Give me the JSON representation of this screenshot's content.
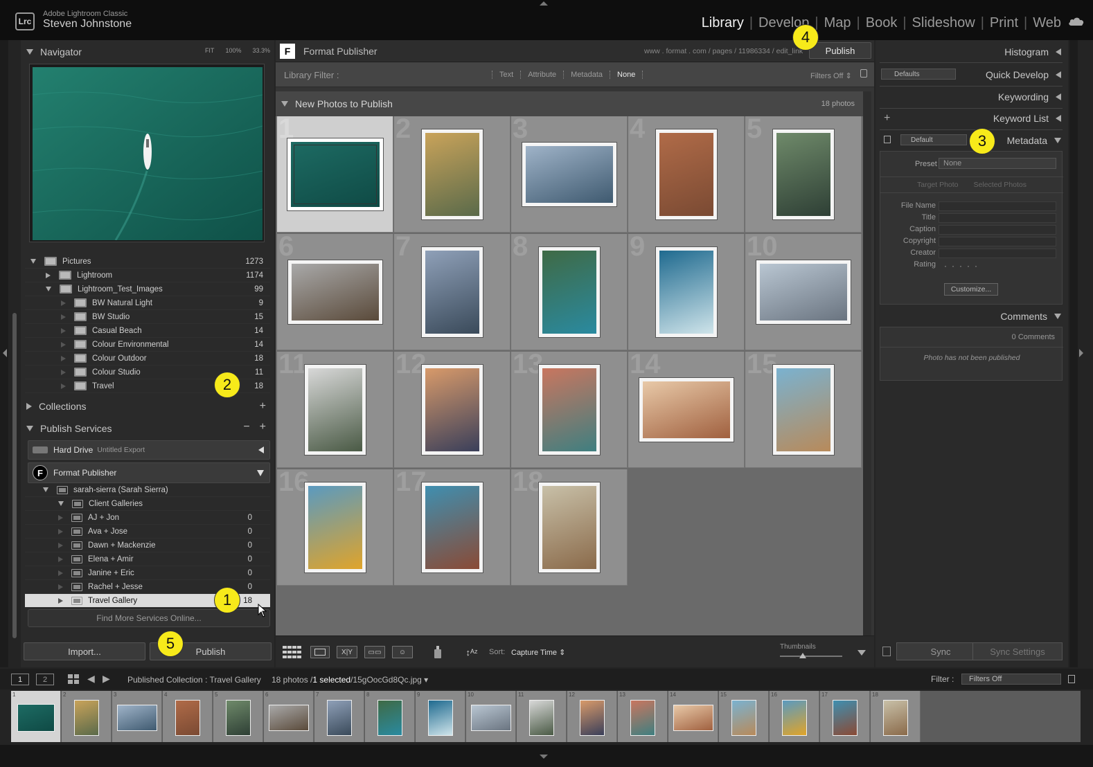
{
  "app": {
    "title": "Adobe Lightroom Classic",
    "user": "Steven Johnstone",
    "logo": "Lrc"
  },
  "modules": [
    "Library",
    "Develop",
    "Map",
    "Book",
    "Slideshow",
    "Print",
    "Web"
  ],
  "active_module": "Library",
  "navigator": {
    "title": "Navigator",
    "zoom": [
      "FIT",
      "100%",
      "33.3%"
    ]
  },
  "folders": [
    {
      "name": "Pictures",
      "count": "1273",
      "level": 0,
      "exp": "down"
    },
    {
      "name": "Lightroom",
      "count": "1174",
      "level": 1,
      "exp": "right"
    },
    {
      "name": "Lightroom_Test_Images",
      "count": "99",
      "level": 1,
      "exp": "down"
    },
    {
      "name": "BW Natural Light",
      "count": "9",
      "level": 2,
      "exp": "faint"
    },
    {
      "name": "BW Studio",
      "count": "15",
      "level": 2,
      "exp": "faint"
    },
    {
      "name": "Casual Beach",
      "count": "14",
      "level": 2,
      "exp": "faint"
    },
    {
      "name": "Colour Environmental",
      "count": "14",
      "level": 2,
      "exp": "faint"
    },
    {
      "name": "Colour Outdoor",
      "count": "18",
      "level": 2,
      "exp": "faint"
    },
    {
      "name": "Colour Studio",
      "count": "11",
      "level": 2,
      "exp": "faint"
    },
    {
      "name": "Travel",
      "count": "18",
      "level": 2,
      "exp": "faint"
    }
  ],
  "collections": {
    "title": "Collections"
  },
  "publish_services": {
    "title": "Publish Services",
    "hard_drive": {
      "name": "Hard Drive",
      "sub": "Untitled Export"
    },
    "format": {
      "name": "Format Publisher",
      "logo": "F"
    },
    "account": "sarah-sierra (Sarah Sierra)",
    "client_galleries": "Client Galleries",
    "galleries": [
      {
        "name": "AJ + Jon",
        "count": "0"
      },
      {
        "name": "Ava + Jose",
        "count": "0"
      },
      {
        "name": "Dawn + Mackenzie",
        "count": "0"
      },
      {
        "name": "Elena + Amir",
        "count": "0"
      },
      {
        "name": "Janine + Eric",
        "count": "0"
      },
      {
        "name": "Rachel + Jesse",
        "count": "0"
      }
    ],
    "travel": {
      "name": "Travel Gallery",
      "count": "18"
    },
    "find_more": "Find More Services Online..."
  },
  "left_buttons": {
    "import": "Import...",
    "publish": "Publish"
  },
  "center": {
    "service_title": "Format Publisher",
    "url": "www . format . com / pages / 11986334 / edit_link",
    "publish": "Publish",
    "filter_label": "Library Filter :",
    "filter_options": [
      "Text",
      "Attribute",
      "Metadata",
      "None"
    ],
    "filters_off": "Filters Off",
    "section_title": "New Photos to Publish",
    "photo_count": "18 photos"
  },
  "photos": [
    {
      "n": "1",
      "o": "l",
      "c1": "#1d6b63",
      "c2": "#0f4a45"
    },
    {
      "n": "2",
      "o": "p",
      "c1": "#c9a35a",
      "c2": "#5a6a4a"
    },
    {
      "n": "3",
      "o": "l",
      "c1": "#9fb3c8",
      "c2": "#3f5a70"
    },
    {
      "n": "4",
      "o": "p",
      "c1": "#b06b48",
      "c2": "#7a4a33"
    },
    {
      "n": "5",
      "o": "p",
      "c1": "#6f8a6a",
      "c2": "#2e3f35"
    },
    {
      "n": "6",
      "o": "l",
      "c1": "#a9a9a9",
      "c2": "#5a4a3a"
    },
    {
      "n": "7",
      "o": "p",
      "c1": "#8fa0b8",
      "c2": "#3a4a5a"
    },
    {
      "n": "8",
      "o": "p",
      "c1": "#3f6a45",
      "c2": "#2a8aa0"
    },
    {
      "n": "9",
      "o": "p",
      "c1": "#1f6a8f",
      "c2": "#cfe4ea"
    },
    {
      "n": "10",
      "o": "l",
      "c1": "#b9c6d2",
      "c2": "#6a7480"
    },
    {
      "n": "11",
      "o": "p",
      "c1": "#d8d8d8",
      "c2": "#4a5a45"
    },
    {
      "n": "12",
      "o": "p",
      "c1": "#d89a6a",
      "c2": "#3a3f5a"
    },
    {
      "n": "13",
      "o": "p",
      "c1": "#c9765f",
      "c2": "#3f7f80"
    },
    {
      "n": "14",
      "o": "l",
      "c1": "#e8c9a8",
      "c2": "#a0603f"
    },
    {
      "n": "15",
      "o": "p",
      "c1": "#7ab2d0",
      "c2": "#b88a5a"
    },
    {
      "n": "16",
      "o": "p",
      "c1": "#5a9ac0",
      "c2": "#e0a42a"
    },
    {
      "n": "17",
      "o": "p",
      "c1": "#3f8fb0",
      "c2": "#8a4a35"
    },
    {
      "n": "18",
      "o": "p",
      "c1": "#c8c0a8",
      "c2": "#8a6a4a"
    }
  ],
  "toolbar": {
    "sort_label": "Sort:",
    "sort_value": "Capture Time",
    "thumbnails": "Thumbnails"
  },
  "right": {
    "histogram": "Histogram",
    "quick_develop": "Quick Develop",
    "qd_preset": "Defaults",
    "keywording": "Keywording",
    "keyword_list": "Keyword List",
    "metadata": "Metadata",
    "md_preset": "Default",
    "preset_label": "Preset",
    "preset_value": "None",
    "target_photo": "Target Photo",
    "selected_photos": "Selected Photos",
    "fields": [
      "File Name",
      "Title",
      "Caption",
      "Copyright",
      "Creator",
      "Rating"
    ],
    "customize": "Customize...",
    "comments": "Comments",
    "comments_count": "0 Comments",
    "comments_msg": "Photo has not been published",
    "sync": "Sync",
    "sync_settings": "Sync Settings"
  },
  "filmstrip_bar": {
    "screen1": "1",
    "screen2": "2",
    "path": "Published Collection : Travel Gallery",
    "count_text": "18 photos /",
    "selected_text": "1 selected",
    "file_text": "/15gOocGd8Qc.jpg",
    "filter_label": "Filter :",
    "filter_value": "Filters Off"
  },
  "callouts": [
    "1",
    "2",
    "3",
    "4",
    "5"
  ],
  "colors": {
    "callout": "#f7ea1a",
    "selected_cell": "#cfcfcf"
  }
}
